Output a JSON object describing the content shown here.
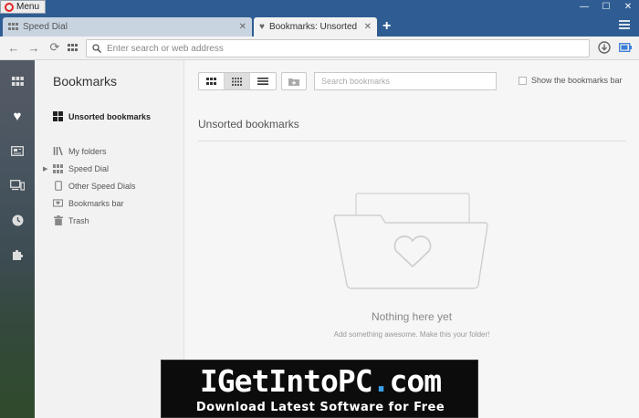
{
  "titlebar": {
    "menu_label": "Menu",
    "controls": [
      "—",
      "☐",
      "✕"
    ]
  },
  "tabs": [
    {
      "label": "Speed Dial",
      "active": false
    },
    {
      "label": "Bookmarks: Unsorted boo",
      "active": true
    }
  ],
  "new_tab_label": "+",
  "address": {
    "placeholder": "Enter search or web address"
  },
  "sidebar": {
    "items": [
      "speed-dial-icon",
      "bookmarks-icon",
      "news-icon",
      "tabs-sync-icon",
      "history-icon",
      "extensions-icon"
    ]
  },
  "bookmarks_panel": {
    "title": "Bookmarks",
    "selected": "Unsorted bookmarks",
    "my_folders_label": "My folders",
    "items": [
      "Speed Dial",
      "Other Speed Dials",
      "Bookmarks bar",
      "Trash"
    ]
  },
  "toolbar": {
    "search_placeholder": "Search bookmarks",
    "show_bar_label": "Show the bookmarks bar"
  },
  "content": {
    "section_title": "Unsorted bookmarks",
    "empty_title": "Nothing here yet",
    "empty_subtitle": "Add something awesome. Make this your folder!"
  },
  "watermark": {
    "brand_prefix": "IGetIntoPC",
    "brand_dot": ".",
    "brand_suffix": "com",
    "tagline": "Download Latest Software for Free"
  },
  "colors": {
    "titlebar": "#2f5d93",
    "opera_red": "#e02424",
    "watermark_accent": "#3aa0e8"
  }
}
